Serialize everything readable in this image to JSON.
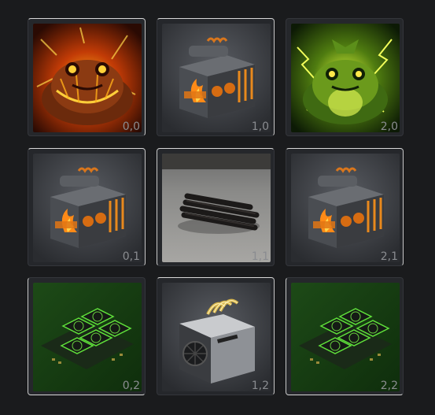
{
  "cells": [
    {
      "coord": "0,0",
      "item": "fire-toad"
    },
    {
      "coord": "1,0",
      "item": "campfire-crate"
    },
    {
      "coord": "2,0",
      "item": "electric-toad"
    },
    {
      "coord": "0,1",
      "item": "campfire-crate"
    },
    {
      "coord": "1,1",
      "item": "charcoal-logs"
    },
    {
      "coord": "2,1",
      "item": "campfire-crate"
    },
    {
      "coord": "0,2",
      "item": "gpu-rig"
    },
    {
      "coord": "1,2",
      "item": "asic-miner"
    },
    {
      "coord": "2,2",
      "item": "gpu-rig"
    }
  ],
  "colors": {
    "background": "#1a1b1d",
    "cell": "#25272b",
    "coord_text": "#8a8c90"
  }
}
